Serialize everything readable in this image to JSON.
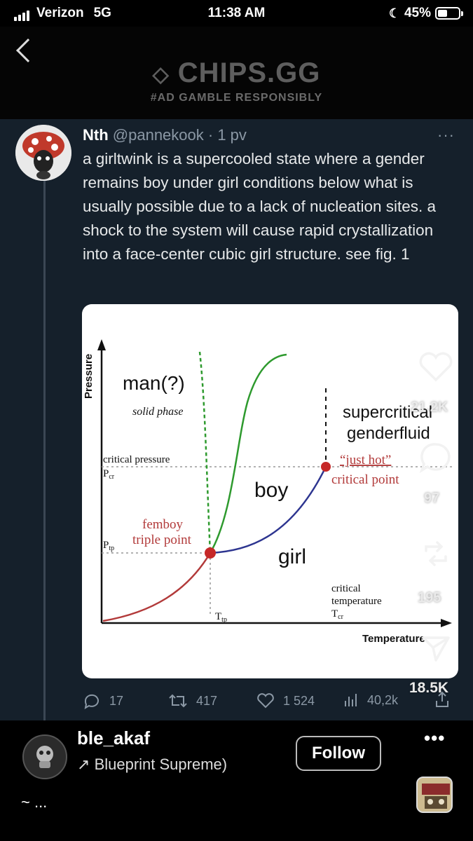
{
  "status_bar": {
    "carrier": "Verizon",
    "network": "5G",
    "time": "11:38 AM",
    "battery": "45%",
    "battery_level": 0.45
  },
  "ad_banner": {
    "brand": "CHIPS.GG",
    "tagline": "#AD  GAMBLE RESPONSIBLY"
  },
  "tweet": {
    "display_name": "Nth",
    "handle": "@pannekook",
    "time": "· 1 pv",
    "more": "···",
    "text": "a girltwink is a supercooled state where a gender remains boy under girl conditions below what is usually possible due to a lack of nucleation sites. a shock to the system will cause rapid crystallization into a face-center cubic girl structure. see fig. 1",
    "replies": "17",
    "retweets": "417",
    "likes": "1 524",
    "views": "40,2k"
  },
  "figure": {
    "y_axis": "Pressure",
    "x_axis": "Temperature",
    "regions": {
      "man": "man(?)",
      "solid": "solid phase",
      "boy": "boy",
      "girl": "girl",
      "super1": "supercritical",
      "super2": "genderfluid"
    },
    "critical_pressure": "critical pressure",
    "p_cr": "P",
    "p_cr_sub": "cr",
    "p_tp": "P",
    "p_tp_sub": "tp",
    "t_tp": "T",
    "t_tp_sub": "tp",
    "t_cr": "T",
    "t_cr_sub": "cr",
    "triple1": "femboy",
    "triple2": "triple point",
    "crit_quote": "“just hot”",
    "crit_point": "critical point",
    "crit_temp1": "critical",
    "crit_temp2": "temperature",
    "colors": {
      "red": "#b23a3a",
      "green": "#2e9a2e",
      "blue": "#2d3590",
      "point": "#c62828"
    }
  },
  "side_actions": {
    "likes": "21.2K",
    "comments": "97",
    "shares": "195",
    "sends": "18.5K"
  },
  "bottom": {
    "username": "ble_akaf",
    "music": "Blueprint Supreme)",
    "music_arrow": "↗",
    "follow": "Follow",
    "more": "•••",
    "caption": "~ ..."
  }
}
